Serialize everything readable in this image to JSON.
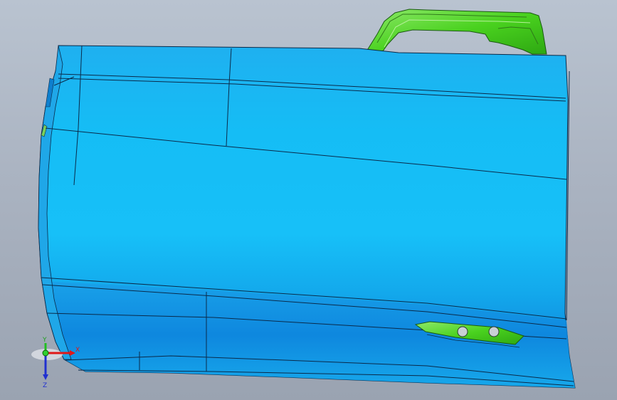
{
  "viewport": {
    "background_top": "#b9c3d0",
    "background_bottom": "#9aa3b1"
  },
  "model": {
    "panel_color": "#19b6f2",
    "panel_dark": "#0f86d8",
    "bracket_color": "#4ad21f",
    "edge_color": "#0a2a4a"
  },
  "triad": {
    "x_label": "X",
    "y_label": "Y",
    "z_label": "Z",
    "x_color": "#e01818",
    "y_color": "#20c020",
    "z_color": "#2030d0"
  }
}
